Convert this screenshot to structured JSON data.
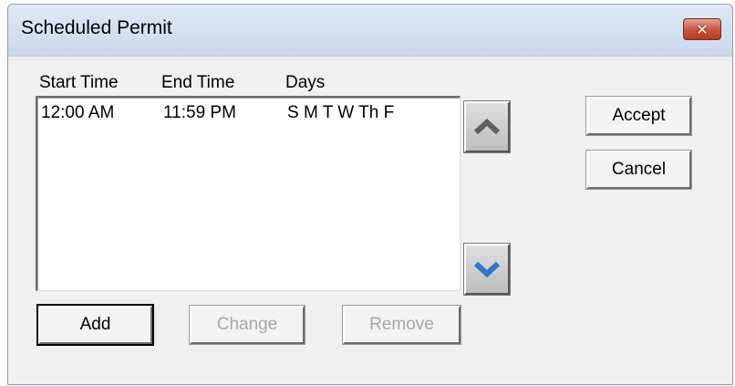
{
  "window": {
    "title": "Scheduled Permit",
    "close_label": "✕"
  },
  "list": {
    "headers": [
      "Start Time",
      "End Time",
      "Days"
    ],
    "rows": [
      {
        "start": "12:00 AM",
        "end": "11:59 PM",
        "days": "S M T W Th F"
      }
    ]
  },
  "buttons": {
    "move_up_icon": "chevron-up-icon",
    "move_down_icon": "chevron-down-icon",
    "add": "Add",
    "change": "Change",
    "remove": "Remove",
    "accept": "Accept",
    "cancel": "Cancel"
  },
  "colors": {
    "up_chevron": "#606060",
    "down_chevron": "#2f78c8",
    "close_button": "#c9513a"
  }
}
